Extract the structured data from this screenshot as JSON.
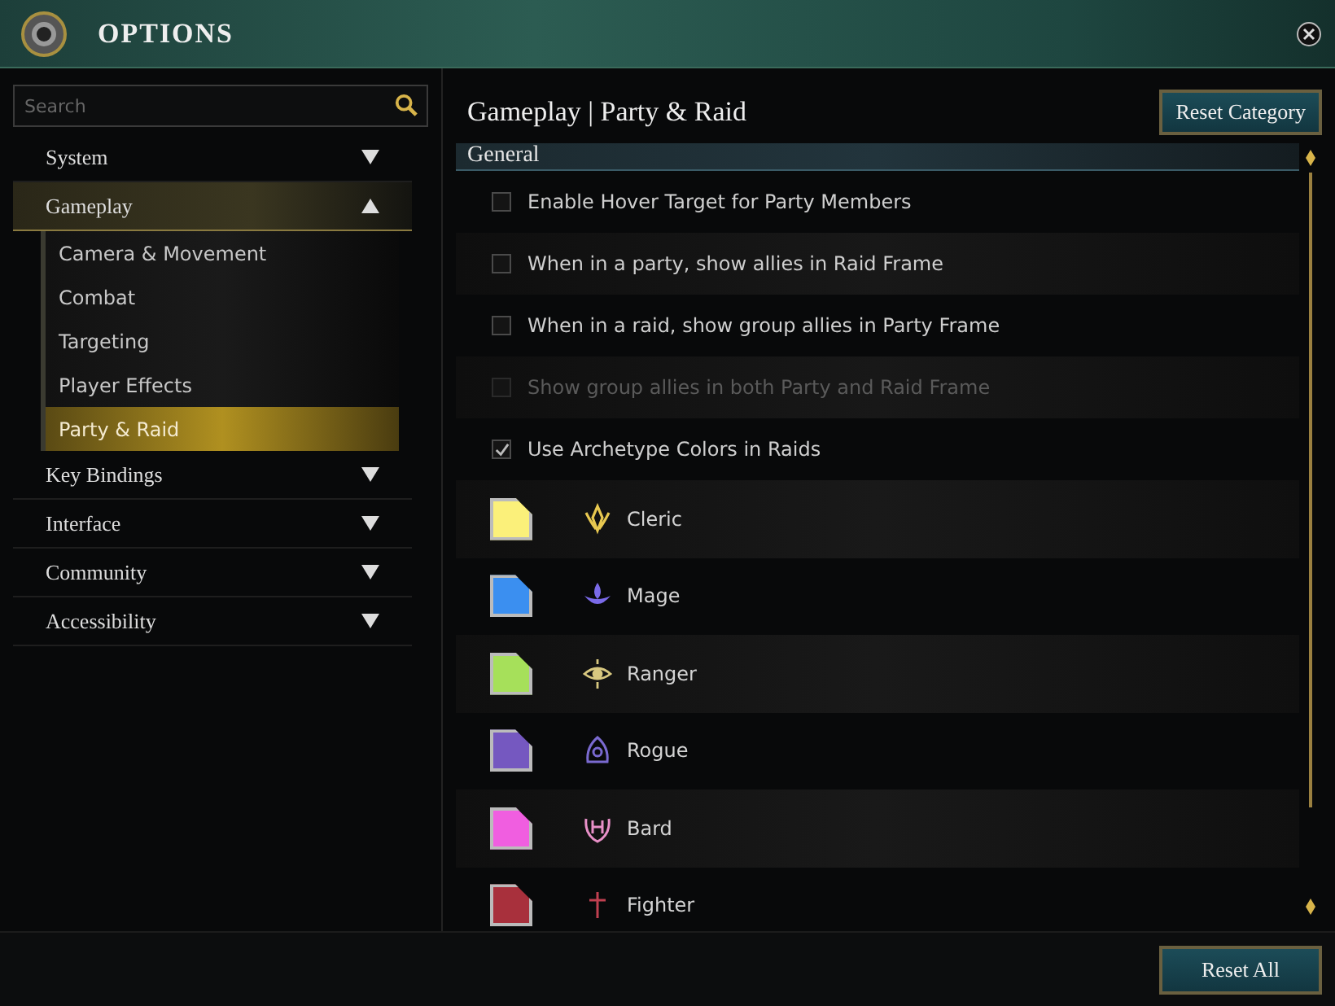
{
  "window": {
    "title": "OPTIONS"
  },
  "search": {
    "placeholder": "Search"
  },
  "sidebar": {
    "items": [
      {
        "label": "System",
        "expanded": false,
        "selected": false
      },
      {
        "label": "Gameplay",
        "expanded": true,
        "selected": true,
        "children": [
          {
            "label": "Camera & Movement",
            "selected": false
          },
          {
            "label": "Combat",
            "selected": false
          },
          {
            "label": "Targeting",
            "selected": false
          },
          {
            "label": "Player Effects",
            "selected": false
          },
          {
            "label": "Party & Raid",
            "selected": true
          }
        ]
      },
      {
        "label": "Key Bindings",
        "expanded": false,
        "selected": false
      },
      {
        "label": "Interface",
        "expanded": false,
        "selected": false
      },
      {
        "label": "Community",
        "expanded": false,
        "selected": false
      },
      {
        "label": "Accessibility",
        "expanded": false,
        "selected": false
      }
    ]
  },
  "content": {
    "title": "Gameplay | Party & Raid",
    "reset_button": "Reset Category",
    "section": "General",
    "settings": [
      {
        "label": "Enable Hover Target for Party Members",
        "checked": false,
        "disabled": false
      },
      {
        "label": "When in a party, show allies in Raid Frame",
        "checked": false,
        "disabled": false
      },
      {
        "label": "When in a raid, show group allies in Party Frame",
        "checked": false,
        "disabled": false
      },
      {
        "label": "Show group allies in both Party and Raid Frame",
        "checked": false,
        "disabled": true
      },
      {
        "label": "Use Archetype Colors in Raids",
        "checked": true,
        "disabled": false
      }
    ],
    "archetypes": [
      {
        "name": "Cleric",
        "color": "#fbf07a"
      },
      {
        "name": "Mage",
        "color": "#3b8ff0"
      },
      {
        "name": "Ranger",
        "color": "#a6e05a"
      },
      {
        "name": "Rogue",
        "color": "#7558c0"
      },
      {
        "name": "Bard",
        "color": "#f05ee0"
      },
      {
        "name": "Fighter",
        "color": "#a8303c"
      }
    ]
  },
  "footer": {
    "reset_all": "Reset All"
  }
}
